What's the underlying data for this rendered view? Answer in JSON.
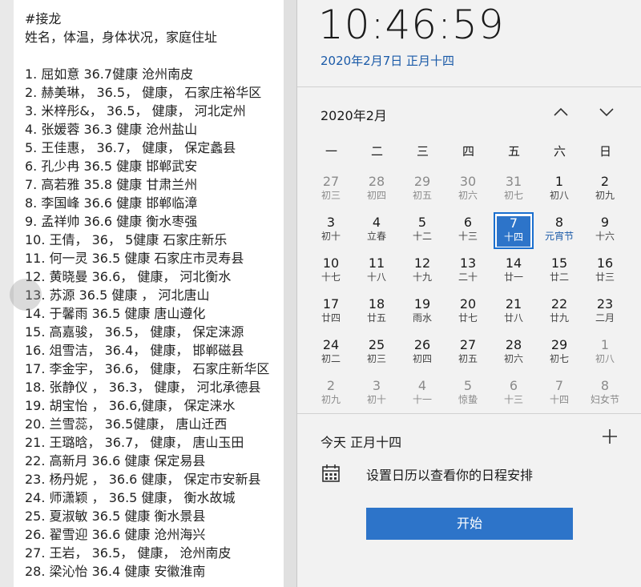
{
  "note": {
    "lines": [
      "#接龙",
      "姓名，体温，身体状况，家庭住址",
      "",
      "1. 屈如意  36.7健康 沧州南皮",
      "2. 赫美琳， 36.5， 健康， 石家庄裕华区",
      "3. 米梓彤&， 36.5， 健康， 河北定州",
      "4. 张媛蓉   36.3  健康  沧州盐山",
      "5. 王佳惠， 36.7， 健康， 保定蠡县",
      "6. 孔少冉   36.5  健康   邯郸武安",
      "7. 高若雅  35.8  健康  甘肃兰州",
      "8. 李国峰  36.6  健康   邯郸临漳",
      "9. 孟祥帅 36.6 健康 衡水枣强",
      "10. 王倩， 36， 5健康 石家庄新乐",
      "11. 何一灵  36.5 健康  石家庄市灵寿县",
      "12. 黄晓曼 36.6， 健康， 河北衡水",
      "13. 苏源   36.5   健康 ， 河北唐山",
      "14. 于馨雨  36.5  健康 唐山遵化",
      "15. 高嘉骏， 36.5， 健康， 保定涞源",
      "16. 俎雪洁， 36.4， 健康， 邯郸磁县",
      "17. 李金宇， 36.6， 健康， 石家庄新华区",
      "18. 张静仪 ， 36.3， 健康， 河北承德县",
      "19. 胡宝怡 ， 36.6,健康， 保定涞水",
      "20. 兰雪蕊， 36.5健康， 唐山迁西",
      "21. 王璐晗， 36.7， 健康， 唐山玉田",
      "22. 高新月 36.6  健康  保定易县",
      "23. 杨丹妮 ， 36.6    健康， 保定市安新县",
      "24. 师潇颖 ， 36.5    健康， 衡水故城",
      "25. 夏淑敏   36.5    健康    衡水景县",
      "26. 翟雪迎  36.6  健康    沧州海兴",
      "27. 王岩， 36.5， 健康， 沧州南皮",
      "28. 梁沁怡 36.4  健康 安徽淮南"
    ]
  },
  "clock": {
    "time": "10:46:59",
    "date_link": "2020年2月7日 正月十四"
  },
  "calendar": {
    "month_title": "2020年2月",
    "prev_icon": "chevron-up-icon",
    "next_icon": "chevron-down-icon",
    "weekdays": [
      "一",
      "二",
      "三",
      "四",
      "五",
      "六",
      "日"
    ],
    "weeks": [
      [
        {
          "n": "27",
          "l": "初三",
          "dim": true
        },
        {
          "n": "28",
          "l": "初四",
          "dim": true
        },
        {
          "n": "29",
          "l": "初五",
          "dim": true
        },
        {
          "n": "30",
          "l": "初六",
          "dim": true
        },
        {
          "n": "31",
          "l": "初七",
          "dim": true
        },
        {
          "n": "1",
          "l": "初八"
        },
        {
          "n": "2",
          "l": "初九"
        }
      ],
      [
        {
          "n": "3",
          "l": "初十"
        },
        {
          "n": "4",
          "l": "立春"
        },
        {
          "n": "5",
          "l": "十二"
        },
        {
          "n": "6",
          "l": "十三"
        },
        {
          "n": "7",
          "l": "十四",
          "today": true
        },
        {
          "n": "8",
          "l": "元宵节",
          "fest": true
        },
        {
          "n": "9",
          "l": "十六"
        }
      ],
      [
        {
          "n": "10",
          "l": "十七"
        },
        {
          "n": "11",
          "l": "十八"
        },
        {
          "n": "12",
          "l": "十九"
        },
        {
          "n": "13",
          "l": "二十"
        },
        {
          "n": "14",
          "l": "廿一"
        },
        {
          "n": "15",
          "l": "廿二"
        },
        {
          "n": "16",
          "l": "廿三"
        }
      ],
      [
        {
          "n": "17",
          "l": "廿四"
        },
        {
          "n": "18",
          "l": "廿五"
        },
        {
          "n": "19",
          "l": "雨水"
        },
        {
          "n": "20",
          "l": "廿七"
        },
        {
          "n": "21",
          "l": "廿八"
        },
        {
          "n": "22",
          "l": "廿九"
        },
        {
          "n": "23",
          "l": "二月"
        }
      ],
      [
        {
          "n": "24",
          "l": "初二"
        },
        {
          "n": "25",
          "l": "初三"
        },
        {
          "n": "26",
          "l": "初四"
        },
        {
          "n": "27",
          "l": "初五"
        },
        {
          "n": "28",
          "l": "初六"
        },
        {
          "n": "29",
          "l": "初七"
        },
        {
          "n": "1",
          "l": "初八",
          "dim": true
        }
      ],
      [
        {
          "n": "2",
          "l": "初九",
          "dim": true
        },
        {
          "n": "3",
          "l": "初十",
          "dim": true
        },
        {
          "n": "4",
          "l": "十一",
          "dim": true
        },
        {
          "n": "5",
          "l": "惊蛰",
          "dim": true
        },
        {
          "n": "6",
          "l": "十三",
          "dim": true
        },
        {
          "n": "7",
          "l": "十四",
          "dim": true
        },
        {
          "n": "8",
          "l": "妇女节",
          "dim": true
        }
      ]
    ]
  },
  "agenda": {
    "heading": "今天 正月十四",
    "add_icon": "plus-icon",
    "message": "设置日历以查看你的日程安排",
    "start_label": "开始"
  },
  "colors": {
    "accent": "#2d74c9",
    "link": "#1a5aa8"
  }
}
